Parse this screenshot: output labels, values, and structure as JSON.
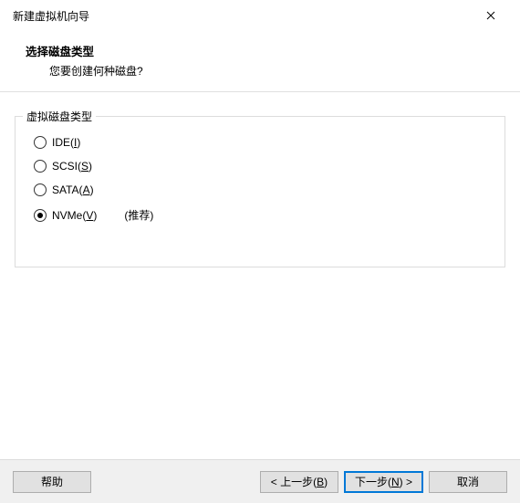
{
  "titlebar": {
    "title": "新建虚拟机向导"
  },
  "header": {
    "title": "选择磁盘类型",
    "subtitle": "您要创建何种磁盘?"
  },
  "group": {
    "legend": "虚拟磁盘类型",
    "options": [
      {
        "prefix": "IDE(",
        "accel": "I",
        "suffix": ")",
        "selected": false
      },
      {
        "prefix": "SCSI(",
        "accel": "S",
        "suffix": ")",
        "selected": false
      },
      {
        "prefix": "SATA(",
        "accel": "A",
        "suffix": ")",
        "selected": false
      },
      {
        "prefix": "NVMe(",
        "accel": "V",
        "suffix": ")",
        "selected": true,
        "recommended": "(推荐)"
      }
    ]
  },
  "footer": {
    "help": "帮助",
    "back": {
      "prefix": "< 上一步(",
      "accel": "B",
      "suffix": ")"
    },
    "next": {
      "prefix": "下一步(",
      "accel": "N",
      "suffix": ") >"
    },
    "cancel": "取消"
  }
}
